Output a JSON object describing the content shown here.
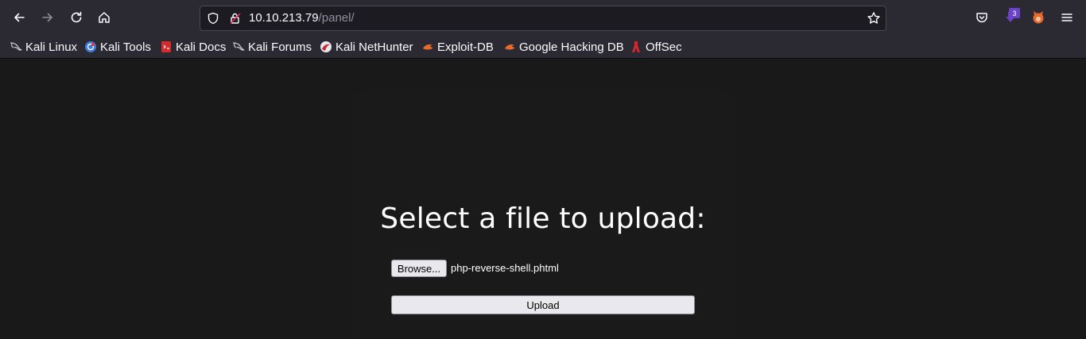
{
  "browser": {
    "url_host": "10.10.213.79",
    "url_path": "/panel/",
    "extension_badge_count": "3"
  },
  "bookmarks": [
    {
      "label": "Kali Linux",
      "icon": "kali-dragon-icon"
    },
    {
      "label": "Kali Tools",
      "icon": "kali-tools-icon"
    },
    {
      "label": "Kali Docs",
      "icon": "kali-docs-icon"
    },
    {
      "label": "Kali Forums",
      "icon": "kali-dragon-icon"
    },
    {
      "label": "Kali NetHunter",
      "icon": "nethunter-icon"
    },
    {
      "label": "Exploit-DB",
      "icon": "exploit-db-icon"
    },
    {
      "label": "Google Hacking DB",
      "icon": "exploit-db-icon"
    },
    {
      "label": "OffSec",
      "icon": "offsec-icon"
    }
  ],
  "page": {
    "heading": "Select a file to upload:",
    "browse_label": "Browse...",
    "selected_file": "php-reverse-shell.phtml",
    "upload_label": "Upload"
  },
  "colors": {
    "toolbar": "#2b2a33",
    "page_bg": "#1a191a",
    "button_bg": "#e9e9ed"
  }
}
